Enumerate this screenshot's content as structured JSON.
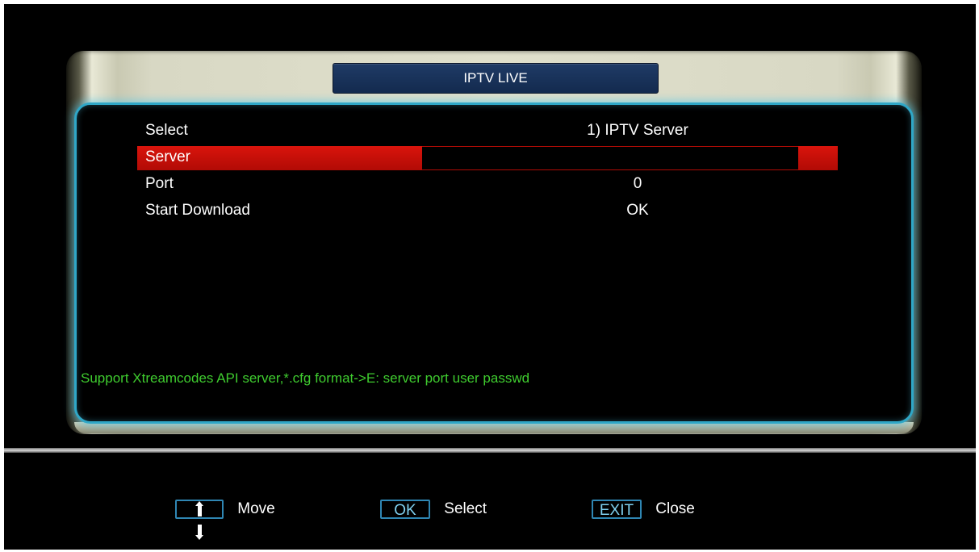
{
  "window": {
    "title": "IPTV LIVE"
  },
  "menu": {
    "rows": [
      {
        "label": "Select",
        "value": "1) IPTV Server"
      },
      {
        "label": "Server",
        "value": ""
      },
      {
        "label": "Port",
        "value": "0"
      },
      {
        "label": "Start Download",
        "value": "OK"
      }
    ],
    "selected_index": 1
  },
  "hint": "Support Xtreamcodes API server,*.cfg format->E: server port user passwd",
  "footer": {
    "move": {
      "key": "↑↓",
      "label": "Move"
    },
    "select": {
      "key": "OK",
      "label": "Select"
    },
    "close": {
      "key": "EXIT",
      "label": "Close"
    }
  },
  "colors": {
    "highlight": "#d9140c",
    "panel_border": "#2fa7c7",
    "hint_text": "#3fcc2f",
    "title_bg": "#1f3b66"
  }
}
